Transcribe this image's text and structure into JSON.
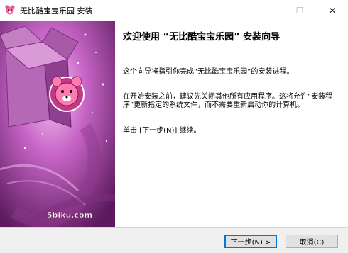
{
  "window": {
    "title": "无比酷宝宝乐园 安装",
    "minimize_glyph": "—",
    "maximize_glyph": "☐",
    "close_glyph": "✕"
  },
  "banner": {
    "logo_text": "5biku.com",
    "colors": {
      "dark": "#5a1a5c",
      "mid": "#a33aa5",
      "light": "#e6a6e4"
    }
  },
  "welcome": {
    "heading": "欢迎使用 “无比酷宝宝乐园” 安装向导",
    "para1": "这个向导将指引你完成“无比酷宝宝乐园”的安装进程。",
    "para2": "在开始安装之前，建议先关闭其他所有应用程序。这将允许“安装程序”更新指定的系统文件，而不需要重新启动你的计算机。",
    "para3": "单击 [下一步(N)] 继续。"
  },
  "buttons": {
    "next": "下一步(N) >",
    "cancel": "取消(C)"
  }
}
